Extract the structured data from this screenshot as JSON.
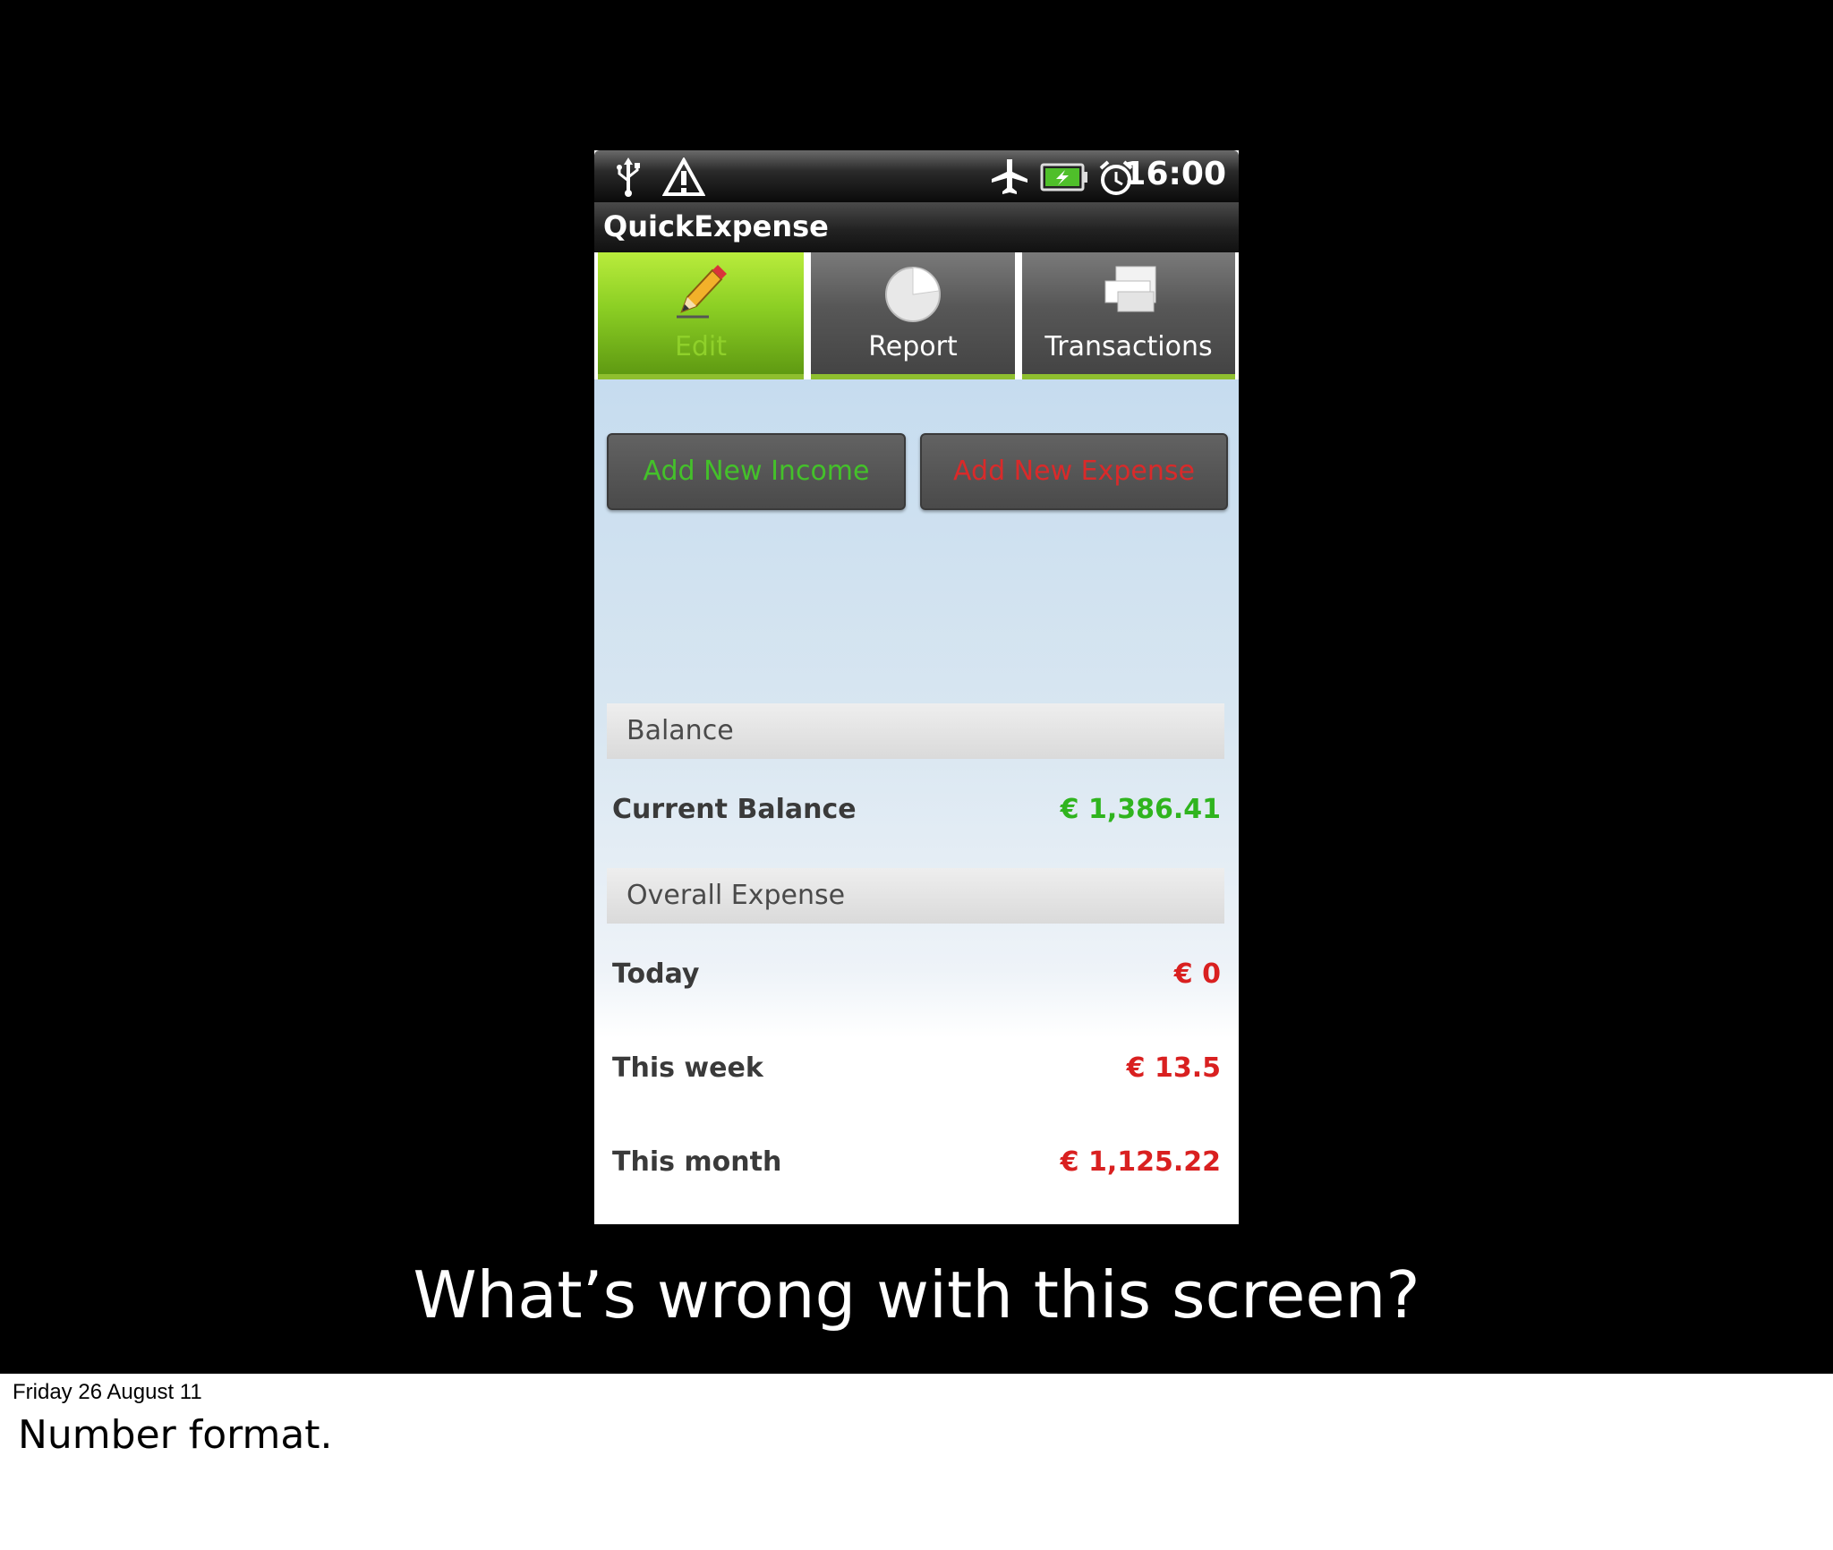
{
  "status_bar": {
    "time": "16:00",
    "left_icons": [
      "usb-icon",
      "warning-icon"
    ],
    "right_icons": [
      "airplane-icon",
      "battery-charging-icon",
      "alarm-icon"
    ]
  },
  "app": {
    "title": "QuickExpense"
  },
  "tabs": [
    {
      "label": "Edit",
      "icon": "pencil-icon",
      "active": true
    },
    {
      "label": "Report",
      "icon": "pie-chart-icon",
      "active": false
    },
    {
      "label": "Transactions",
      "icon": "stack-icon",
      "active": false
    }
  ],
  "actions": {
    "add_income": "Add New Income",
    "add_expense": "Add New Expense"
  },
  "balance_section": {
    "header": "Balance",
    "current_label": "Current Balance",
    "current_value": "€ 1,386.41"
  },
  "expense_section": {
    "header": "Overall Expense",
    "rows": [
      {
        "label": "Today",
        "value": "€ 0"
      },
      {
        "label": "This week",
        "value": "€ 13.5"
      },
      {
        "label": "This month",
        "value": "€ 1,125.22"
      }
    ]
  },
  "slide": {
    "question": "What’s wrong with this screen?"
  },
  "notes": {
    "date": "Friday 26 August 11",
    "text": "Number format."
  },
  "colors": {
    "active_tab": "#8ccf24",
    "income": "#2fb41e",
    "expense": "#d92020"
  }
}
